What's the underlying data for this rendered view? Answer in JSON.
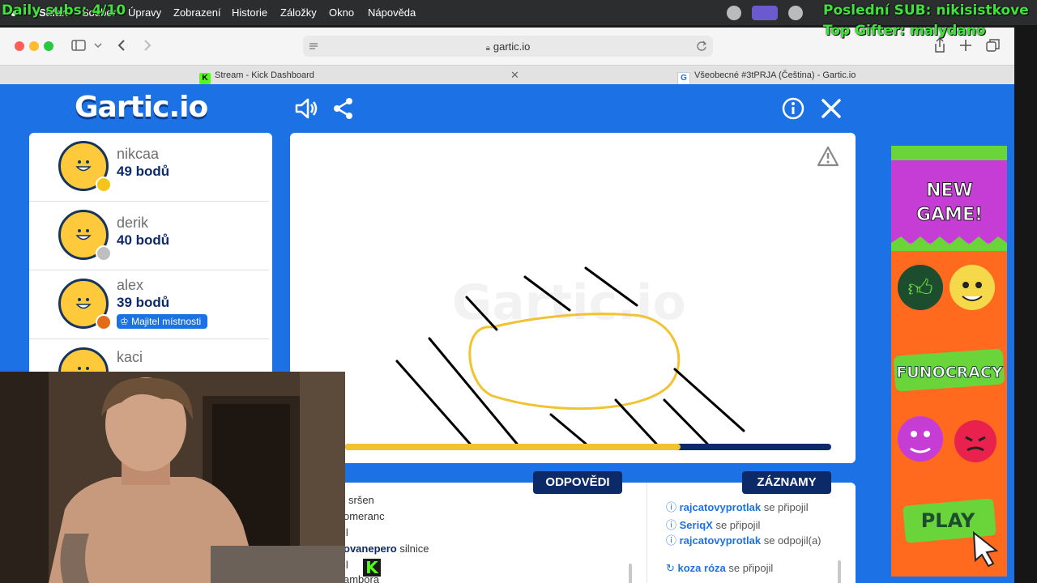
{
  "menubar": {
    "items": [
      "Safari",
      "Soubor",
      "Úpravy",
      "Zobrazení",
      "Historie",
      "Záložky",
      "Okno",
      "Nápověda"
    ]
  },
  "overlay": {
    "daily_subs": "Daily subs: 4/10",
    "last_sub": "Poslední SUB: nikisistkove",
    "top_gifter": "Top Gifter: malydano"
  },
  "browser": {
    "address": "gartic.io",
    "tabs": [
      {
        "title": "Stream - Kick Dashboard",
        "icon": "kick-favicon"
      },
      {
        "title": "Všeobecné #3tPRJA (Čeština) - Gartic.io",
        "icon": "gartic-favicon"
      }
    ]
  },
  "game": {
    "logo": "Gartic.io",
    "players": [
      {
        "name": "nikcaa",
        "score": "49 bodů",
        "status_color": "#f5c518"
      },
      {
        "name": "derik",
        "score": "40 bodů",
        "status_color": "#bfbfbf"
      },
      {
        "name": "alex",
        "score": "39 bodů",
        "status_color": "#e36b1a",
        "badge": "Majitel místnosti"
      },
      {
        "name": "kaci",
        "score": "",
        "status_color": ""
      }
    ],
    "timer_progress": 0.69,
    "answers_label": "ODPOVĚDI",
    "log_label": "ZÁZNAMY",
    "answers": [
      {
        "user": "",
        "text": "sršen"
      },
      {
        "user": "",
        "text": "omeranc"
      },
      {
        "user": "",
        "text": "il"
      },
      {
        "user": "ovanepero",
        "text": "silnice"
      },
      {
        "user": "",
        "text": "il"
      },
      {
        "user": "",
        "text": "ambora"
      }
    ],
    "log": [
      {
        "user": "rajcatovyprotlak",
        "text": "se připojil",
        "icon": "info-icon"
      },
      {
        "user": "SeriqX",
        "text": "se připojil",
        "icon": "info-icon"
      },
      {
        "user": "rajcatovyprotlak",
        "text": "se odpojil(a)",
        "icon": "info-icon"
      },
      {
        "user": "koza róza",
        "text": "se připojil",
        "icon": "loading-icon"
      }
    ]
  },
  "ad": {
    "headline": "NEW GAME!",
    "brand": "FUNOCRACY",
    "cta": "PLAY"
  },
  "colors": {
    "game_bg": "#1c72e4",
    "navy": "#0d2a68",
    "overlay_green": "#3fe33a"
  }
}
